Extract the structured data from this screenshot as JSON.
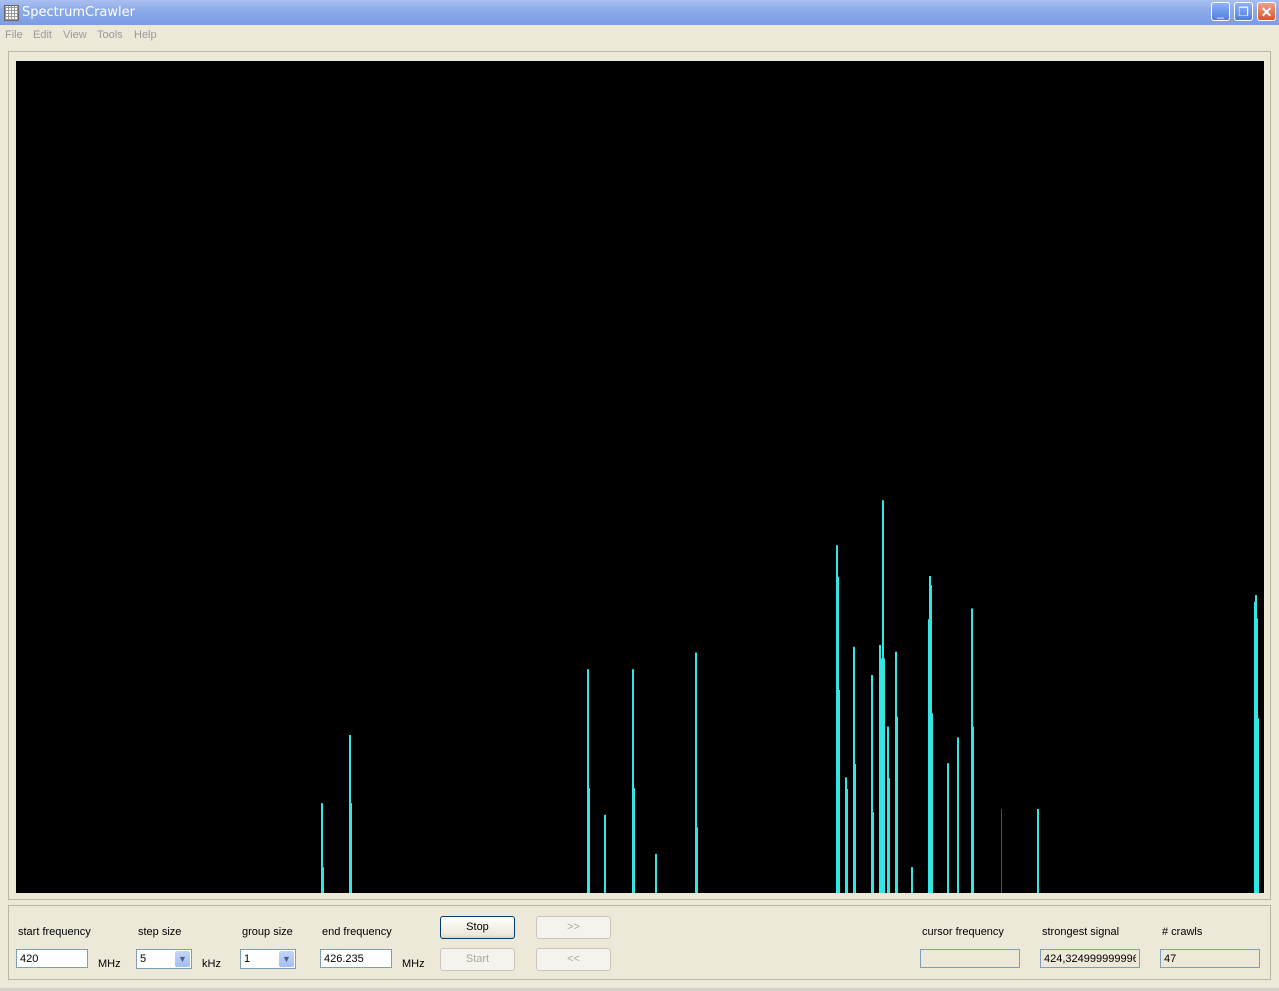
{
  "window": {
    "title": "SpectrumCrawler",
    "buttons": {
      "minimize": "_",
      "maximize": "❐",
      "close": "✕"
    }
  },
  "menu": [
    "File",
    "Edit",
    "View",
    "Tools",
    "Help"
  ],
  "colors": {
    "plot_background": "#000000",
    "signal": "#33e6e6",
    "strongest_marker": "#c81e1e"
  },
  "spectrum": {
    "freq_start_mhz": 420,
    "freq_end_mhz": 426.235,
    "strongest_signal_mhz": 424.325,
    "bars": [
      {
        "f": 421.525,
        "level": 0.108
      },
      {
        "f": 421.53,
        "level": 0.031
      },
      {
        "f": 421.665,
        "level": 0.19
      },
      {
        "f": 421.67,
        "level": 0.108
      },
      {
        "f": 422.855,
        "level": 0.269
      },
      {
        "f": 422.86,
        "level": 0.126
      },
      {
        "f": 422.94,
        "level": 0.094
      },
      {
        "f": 423.08,
        "level": 0.269
      },
      {
        "f": 423.085,
        "level": 0.126
      },
      {
        "f": 423.19,
        "level": 0.047
      },
      {
        "f": 423.39,
        "level": 0.289
      },
      {
        "f": 423.395,
        "level": 0.079
      },
      {
        "f": 424.095,
        "level": 0.418
      },
      {
        "f": 424.1,
        "level": 0.38
      },
      {
        "f": 424.105,
        "level": 0.244
      },
      {
        "f": 424.14,
        "level": 0.139
      },
      {
        "f": 424.145,
        "level": 0.125
      },
      {
        "f": 424.18,
        "level": 0.296
      },
      {
        "f": 424.185,
        "level": 0.155
      },
      {
        "f": 424.27,
        "level": 0.262
      },
      {
        "f": 424.275,
        "level": 0.097
      },
      {
        "f": 424.31,
        "level": 0.298
      },
      {
        "f": 424.315,
        "level": 0.282
      },
      {
        "f": 424.325,
        "level": 0.472
      },
      {
        "f": 424.33,
        "level": 0.282
      },
      {
        "f": 424.35,
        "level": 0.2
      },
      {
        "f": 424.355,
        "level": 0.138
      },
      {
        "f": 424.39,
        "level": 0.29
      },
      {
        "f": 424.395,
        "level": 0.212
      },
      {
        "f": 424.47,
        "level": 0.031
      },
      {
        "f": 424.555,
        "level": 0.329
      },
      {
        "f": 424.56,
        "level": 0.381
      },
      {
        "f": 424.565,
        "level": 0.37
      },
      {
        "f": 424.57,
        "level": 0.216
      },
      {
        "f": 424.65,
        "level": 0.156
      },
      {
        "f": 424.7,
        "level": 0.187
      },
      {
        "f": 424.77,
        "level": 0.342
      },
      {
        "f": 424.775,
        "level": 0.2
      },
      {
        "f": 425.1,
        "level": 0.101
      },
      {
        "f": 426.185,
        "level": 0.35
      },
      {
        "f": 426.19,
        "level": 0.358
      },
      {
        "f": 426.195,
        "level": 0.33
      },
      {
        "f": 426.2,
        "level": 0.21
      }
    ]
  },
  "controls": {
    "start_frequency": {
      "label": "start frequency",
      "value": "420",
      "unit": "MHz"
    },
    "step_size": {
      "label": "step size",
      "value": "5",
      "unit": "kHz"
    },
    "group_size": {
      "label": "group size",
      "value": "1"
    },
    "end_frequency": {
      "label": "end frequency",
      "value": "426.235",
      "unit": "MHz"
    },
    "stop_label": "Stop",
    "start_label": "Start",
    "forward_label": ">>",
    "back_label": "<<",
    "cursor_frequency": {
      "label": "cursor frequency",
      "value": ""
    },
    "strongest_signal": {
      "label": "strongest signal",
      "value": "424,324999999996"
    },
    "crawls": {
      "label": "# crawls",
      "value": "47"
    }
  }
}
